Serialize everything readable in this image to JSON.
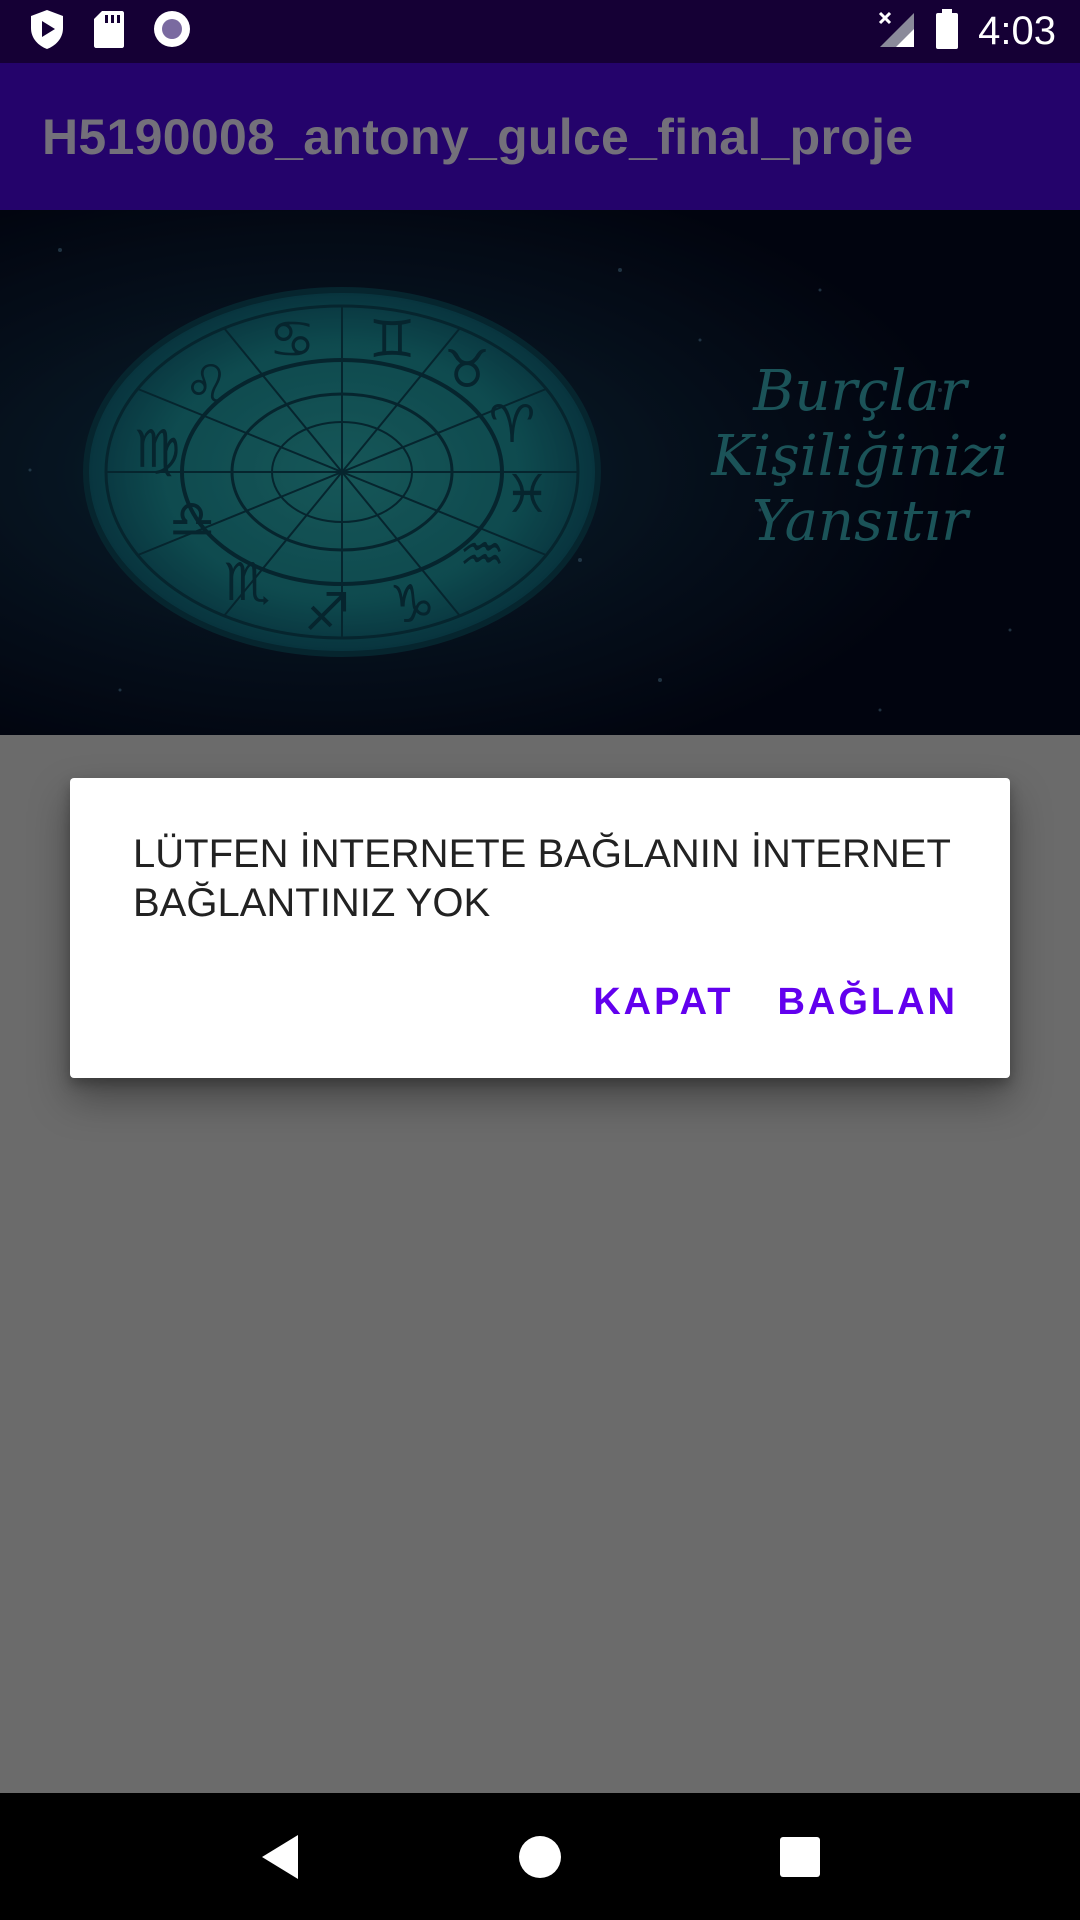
{
  "status_bar": {
    "time": "4:03",
    "left_icons": [
      "play-protect-icon",
      "sd-card-icon",
      "record-icon"
    ],
    "right_icons": [
      "no-signal-icon",
      "battery-icon"
    ]
  },
  "app_bar": {
    "title": "H5190008_antony_gulce_final_proje"
  },
  "banner": {
    "text_lines": [
      "Burçlar",
      "Kişiliğinizi",
      "Yansıtır"
    ]
  },
  "dialog": {
    "message": "LÜTFEN İNTERNETE BAĞLANIN İNTERNET BAĞLANTINIZ YOK",
    "negative_label": "KAPAT",
    "positive_label": "BAĞLAN",
    "accent_color": "#6200ee"
  },
  "nav_bar": {
    "buttons": [
      "back-icon",
      "home-icon",
      "recents-icon"
    ]
  },
  "colors": {
    "status_bar": "#150035",
    "app_bar": "#24036b",
    "scrim_background": "#6b6b6b",
    "banner_wheel": "#1f8d93"
  }
}
